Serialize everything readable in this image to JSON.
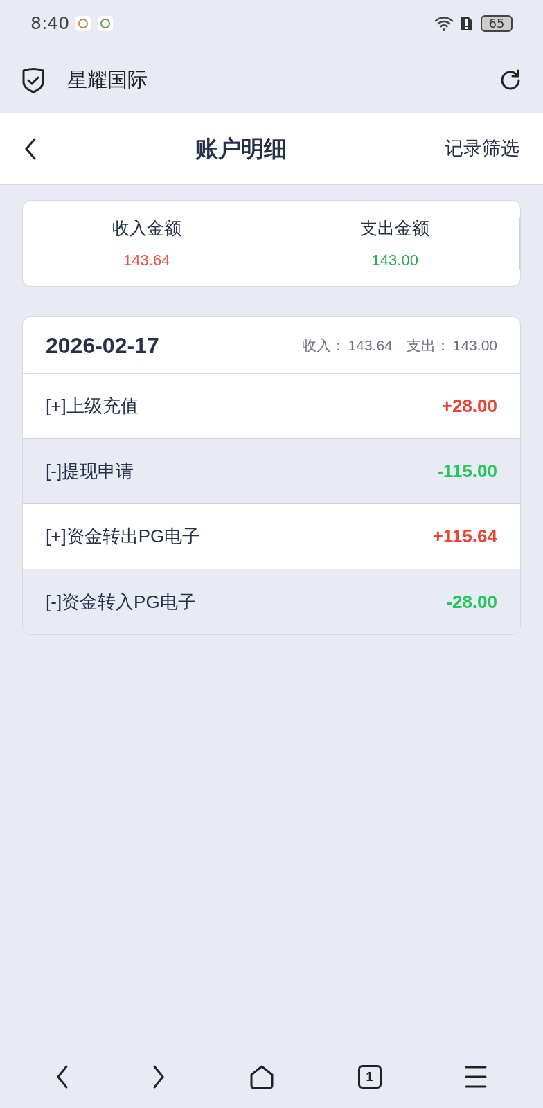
{
  "status_bar": {
    "time": "8:40",
    "battery": "65"
  },
  "browser_bar": {
    "title": "星耀国际"
  },
  "header": {
    "title": "账户明细",
    "action": "记录筛选"
  },
  "summary": [
    {
      "label": "收入金额",
      "value": "143.64",
      "kind": "income"
    },
    {
      "label": "支出金额",
      "value": "143.00",
      "kind": "expense"
    }
  ],
  "day": {
    "date": "2026-02-17",
    "income_label": "收入：",
    "income": "143.64",
    "expense_label": "支出：",
    "expense": "143.00",
    "rows": [
      {
        "label": "[+]上级充值",
        "amount": "+28.00",
        "kind": "income"
      },
      {
        "label": "[-]提现申请",
        "amount": "-115.00",
        "kind": "expense"
      },
      {
        "label": "[+]资金转出PG电子",
        "amount": "+115.64",
        "kind": "income"
      },
      {
        "label": "[-]资金转入PG电子",
        "amount": "-28.00",
        "kind": "expense"
      }
    ]
  },
  "nav_bar": {
    "tab_count": "1"
  }
}
